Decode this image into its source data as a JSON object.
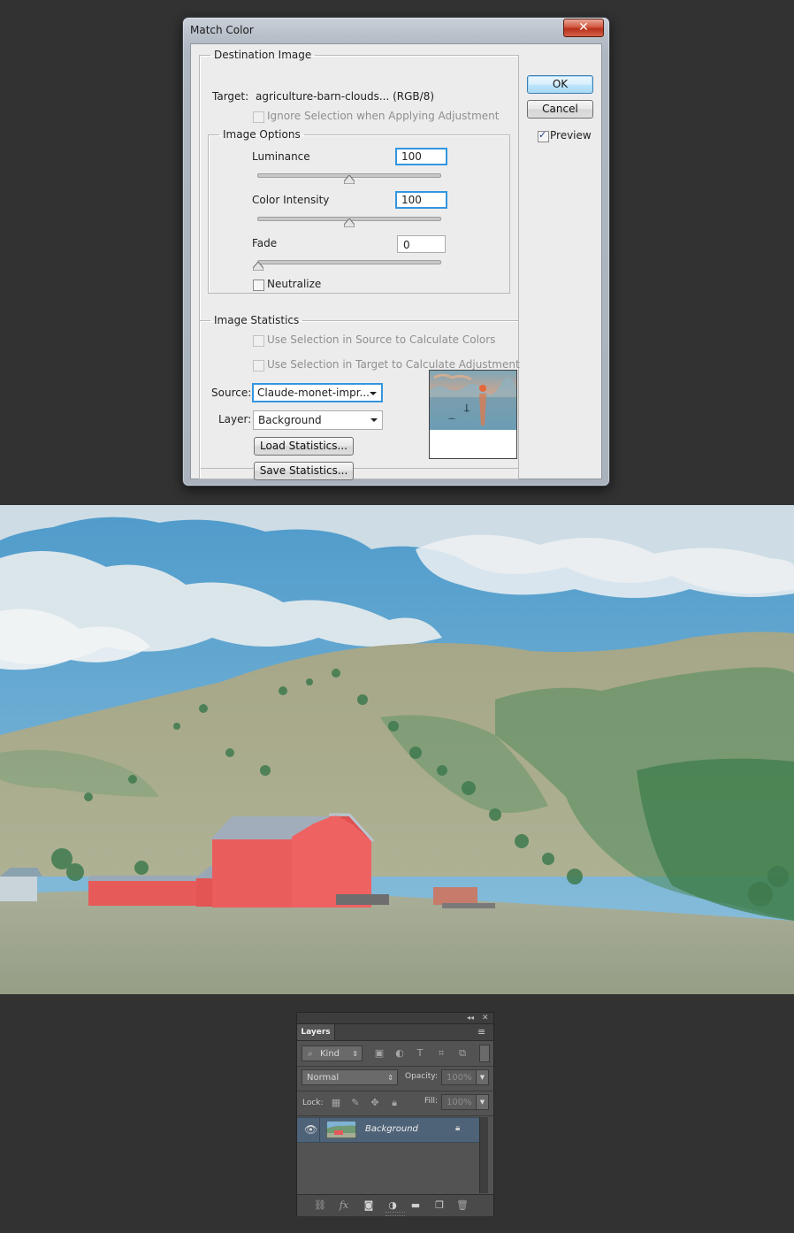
{
  "dialog": {
    "title": "Match Color",
    "close_glyph": "✕",
    "destination": {
      "legend": "Destination Image",
      "target_label": "Target:",
      "target_value": "agriculture-barn-clouds... (RGB/8)",
      "ignore_selection_label": "Ignore Selection when Applying Adjustment",
      "ignore_selection_checked": false,
      "ignore_selection_enabled": false
    },
    "image_options": {
      "legend": "Image Options",
      "luminance_label": "Luminance",
      "luminance_value": "100",
      "luminance_level": 0.5,
      "color_intensity_label": "Color Intensity",
      "color_intensity_value": "100",
      "color_intensity_level": 0.5,
      "fade_label": "Fade",
      "fade_value": "0",
      "fade_level": 0.0,
      "neutralize_label": "Neutralize",
      "neutralize_checked": false
    },
    "image_statistics": {
      "legend": "Image Statistics",
      "use_source_selection_label": "Use Selection in Source to Calculate Colors",
      "use_target_selection_label": "Use Selection in Target to Calculate Adjustment",
      "source_label": "Source:",
      "source_value": "Claude-monet-impr...",
      "layer_label": "Layer:",
      "layer_value": "Background",
      "load_button": "Load Statistics...",
      "save_button": "Save Statistics..."
    },
    "ok_button": "OK",
    "cancel_button": "Cancel",
    "preview_label": "Preview",
    "preview_checked": true
  },
  "layers_panel": {
    "tab_label": "Layers",
    "collapse_glyph": "◂◂",
    "close_glyph": "✕",
    "menu_glyph": "≡",
    "filter_kind_label": "Kind",
    "blend_mode": "Normal",
    "opacity_label": "Opacity:",
    "opacity_value": "100%",
    "lock_label": "Lock:",
    "fill_label": "Fill:",
    "fill_value": "100%",
    "layer_name": "Background",
    "footer_icons": [
      "link-icon",
      "fx-icon",
      "mask-icon",
      "adjustment-icon",
      "folder-icon",
      "new-layer-icon",
      "trash-icon"
    ]
  },
  "colors": {
    "workspace_bg": "#323232",
    "dialog_face": "#ececec",
    "focus_blue": "#3396e0",
    "barn_red": "#e85c5c",
    "sky_blue": "#5aa3cf"
  }
}
